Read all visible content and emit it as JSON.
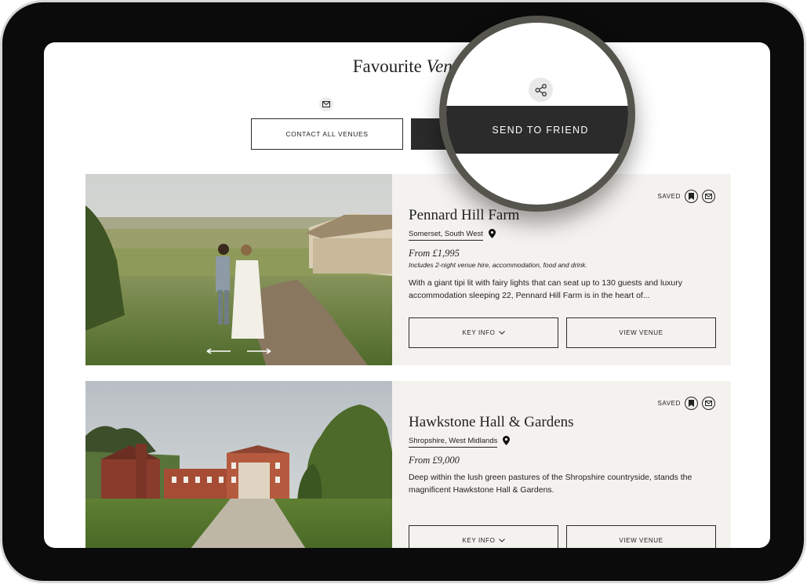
{
  "page": {
    "title_regular": "Favourite ",
    "title_italic": "Venu",
    "contact_all_label": "CONTACT ALL VENUES",
    "send_to_friend_label": "SEND TO FRIEND"
  },
  "venues": [
    {
      "name": "Pennard Hill Farm",
      "location": "Somerset, South West",
      "price": "From £1,995",
      "includes": "Includes 2-night venue hire, accommodation, food and drink.",
      "description": "With a giant tipi lit with fairy lights that can seat up to 130 guests and luxury accommodation sleeping 22, Pennard Hill Farm is in the heart of...",
      "saved_label": "SAVED",
      "key_info_label": "KEY INFO",
      "view_label": "VIEW VENUE"
    },
    {
      "name": "Hawkstone Hall & Gardens",
      "location": "Shropshire, West Midlands",
      "price": "From £9,000",
      "description": "Deep within the lush green pastures of the Shropshire countryside, stands the magnificent Hawkstone Hall & Gardens.",
      "saved_label": "SAVED",
      "key_info_label": "KEY INFO",
      "view_label": "VIEW VENUE"
    }
  ],
  "icons": {
    "mail": "mail-icon",
    "share": "share-icon",
    "bookmark": "bookmark-icon",
    "location": "location-pin-icon",
    "chevron": "chevron-down-icon",
    "arrow_left": "arrow-left-icon",
    "arrow_right": "arrow-right-icon"
  },
  "colors": {
    "dark_button": "#2b2b2b",
    "card_bg": "#f4f2ee",
    "magnifier_ring": "#55554e",
    "device_frame": "#0b0b0b"
  }
}
